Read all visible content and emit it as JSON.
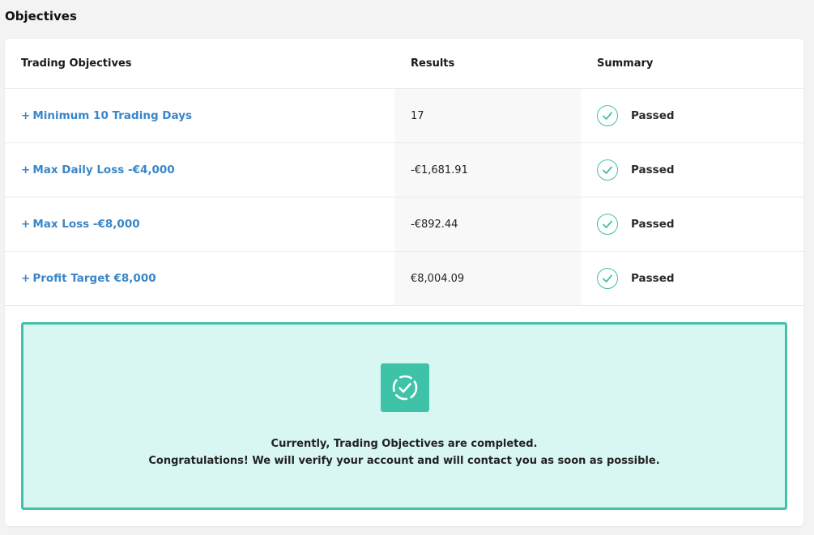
{
  "page": {
    "title": "Objectives"
  },
  "table": {
    "headers": {
      "objective": "Trading Objectives",
      "results": "Results",
      "summary": "Summary"
    },
    "rows": [
      {
        "objective": "Minimum 10 Trading Days",
        "result": "17",
        "status": "Passed"
      },
      {
        "objective": "Max Daily Loss -€4,000",
        "result": "-€1,681.91",
        "status": "Passed"
      },
      {
        "objective": "Max Loss -€8,000",
        "result": "-€892.44",
        "status": "Passed"
      },
      {
        "objective": "Profit Target €8,000",
        "result": "€8,004.09",
        "status": "Passed"
      }
    ],
    "expand_symbol": "+"
  },
  "banner": {
    "icon": "dashed-circle-check-icon",
    "line1": "Currently, Trading Objectives are completed.",
    "line2": "Congratulations! We will verify your account and will contact you as soon as possible."
  },
  "colors": {
    "accent_teal": "#43c1a9",
    "link_blue": "#3a86c8",
    "banner_bg": "#d8f6f2"
  }
}
